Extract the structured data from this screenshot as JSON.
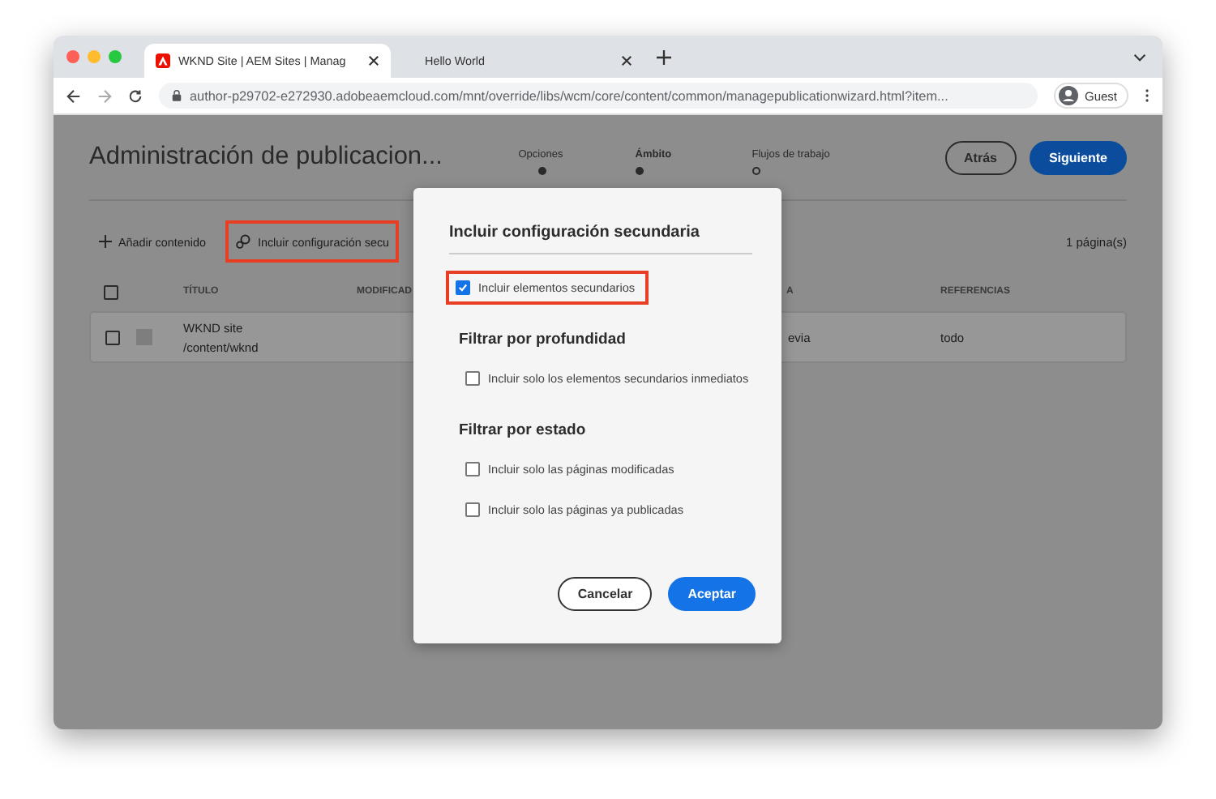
{
  "browser": {
    "tabs": [
      {
        "title": "WKND Site | AEM Sites | Manag",
        "selected": true,
        "favicon": true
      },
      {
        "title": "Hello World",
        "selected": false,
        "favicon": false
      }
    ],
    "url": "author-p29702-e272930.adobeaemcloud.com/mnt/override/libs/wcm/core/content/common/managepublicationwizard.html?item...",
    "profile": "Guest"
  },
  "page": {
    "title": "Administración de publicacion...",
    "steps": [
      {
        "label": "Opciones",
        "done": true,
        "selected": false
      },
      {
        "label": "Ámbito",
        "done": true,
        "selected": true
      },
      {
        "label": "Flujos de trabajo",
        "done": false,
        "selected": false
      }
    ],
    "buttons": [
      {
        "label": "Atrás",
        "kind": "secondary"
      },
      {
        "label": "Siguiente",
        "kind": "primary"
      }
    ],
    "toolbar": [
      {
        "label": "Añadir contenido",
        "kind": "add",
        "highlighted": false
      },
      {
        "label": "Incluir configuración secu",
        "kind": "settings",
        "highlighted": true
      }
    ],
    "count": "1 página(s)",
    "table": {
      "all_checked": false,
      "columns": [
        "TÍTULO",
        "MODIFICAD",
        "A",
        "REFERENCIAS"
      ],
      "rows": [
        {
          "checked": false,
          "title": "WKND site",
          "path": "/content/wknd",
          "column_3": "evia",
          "references": "todo"
        }
      ]
    }
  },
  "dialog": {
    "title": "Incluir configuración secundaria",
    "items": [
      {
        "kind": "checkbox",
        "label": "Incluir elementos secundarios",
        "checked": true,
        "highlighted": true
      },
      {
        "kind": "heading",
        "label": "Filtrar por profundidad"
      },
      {
        "kind": "checkbox",
        "label": "Incluir solo los elementos secundarios inmediatos",
        "checked": false,
        "highlighted": false
      },
      {
        "kind": "heading",
        "label": "Filtrar por estado"
      },
      {
        "kind": "checkbox",
        "label": "Incluir solo las páginas modificadas",
        "checked": false,
        "highlighted": false
      },
      {
        "kind": "checkbox",
        "label": "Incluir solo las páginas ya publicadas",
        "checked": false,
        "highlighted": false
      }
    ],
    "buttons": [
      {
        "label": "Cancelar",
        "kind": "secondary"
      },
      {
        "label": "Aceptar",
        "kind": "primary"
      }
    ]
  }
}
